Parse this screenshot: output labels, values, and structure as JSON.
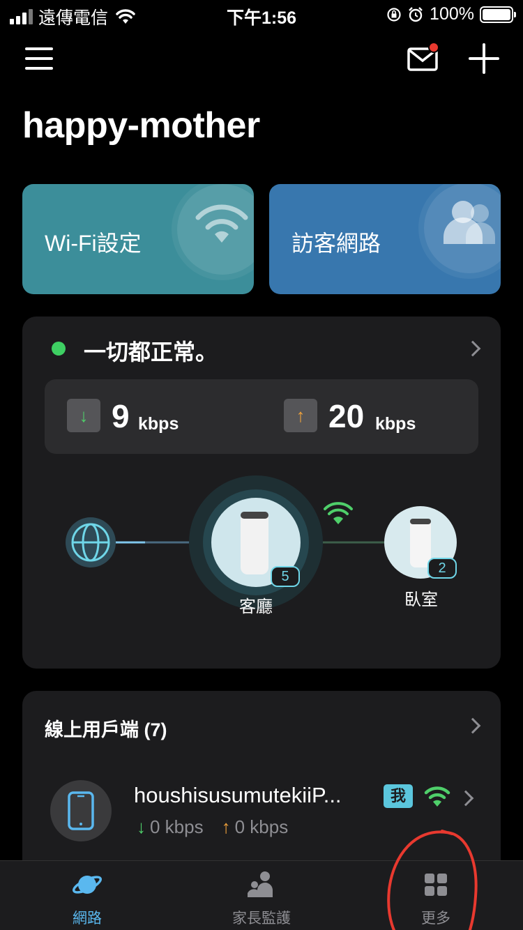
{
  "status_bar": {
    "carrier": "遠傳電信",
    "time": "下午1:56",
    "battery": "100%"
  },
  "header": {
    "network_name": "happy-mother",
    "mail_has_unread": true
  },
  "quick_actions": [
    {
      "label": "Wi-Fi設定",
      "icon": "wifi-icon",
      "color": "#3c8e9a"
    },
    {
      "label": "訪客網路",
      "icon": "guests-icon",
      "color": "#3877ae"
    }
  ],
  "status": {
    "text": "一切都正常。",
    "indicator_color": "#3ecf63",
    "download": {
      "value": "9",
      "unit": "kbps"
    },
    "upload": {
      "value": "20",
      "unit": "kbps"
    }
  },
  "topology": {
    "main_node": {
      "name": "客廳",
      "client_count": "5"
    },
    "satellite_node": {
      "name": "臥室",
      "client_count": "2"
    }
  },
  "clients": {
    "title": "線上用戶端 (7)",
    "items": [
      {
        "name": "houshisusumutekiiP...",
        "me_badge": "我",
        "download": "0 kbps",
        "upload": "0 kbps"
      }
    ]
  },
  "tabbar": {
    "tabs": [
      {
        "label": "網路",
        "icon": "network-planet-icon",
        "active": true
      },
      {
        "label": "家長監護",
        "icon": "parental-control-icon",
        "active": false
      },
      {
        "label": "更多",
        "icon": "more-grid-icon",
        "active": false
      }
    ]
  },
  "colors": {
    "accent": "#5ab8ef",
    "download_arrow": "#4fcf6a",
    "upload_arrow": "#f0a23b",
    "annotation": "#e8392f"
  }
}
